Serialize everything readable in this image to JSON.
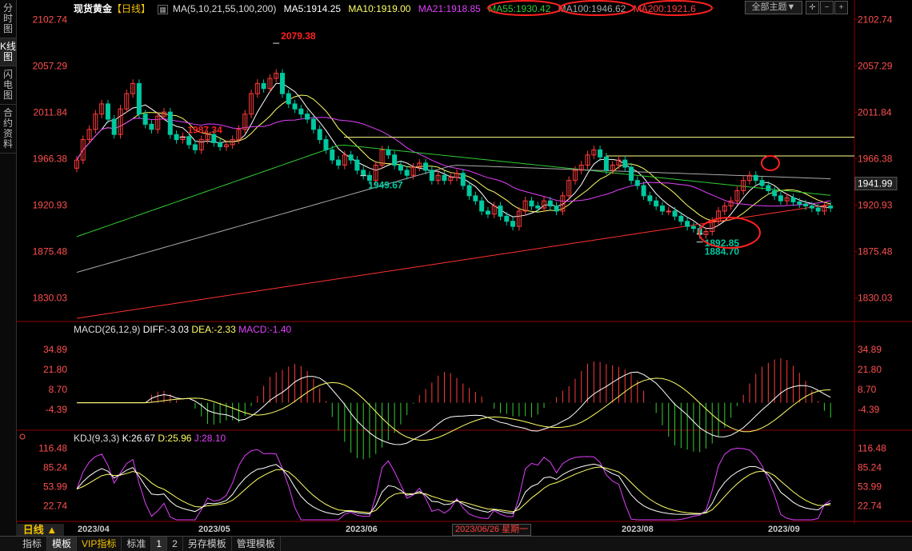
{
  "side_tabs": [
    "分时图",
    "K线图",
    "闪电图",
    "合约资料"
  ],
  "header": {
    "symbol": "现货黄金",
    "period_tag": "【日线】",
    "ma_label": "MA(5,10,21,55,100,200)",
    "ma5": "MA5:1914.25",
    "ma10": "MA10:1919.00",
    "ma21": "MA21:1918.85",
    "ma55": "MA55:1930.42",
    "ma100": "MA100:1946.62",
    "ma200": "MA200:1921.6",
    "theme_label": "全部主题▼"
  },
  "colors": {
    "up": "#ff3b3b",
    "down": "#00c8a0",
    "ma5": "#ffffff",
    "ma10": "#ffff66",
    "ma21": "#e040fb",
    "ma55": "#33cc33",
    "ma100": "#aaaaaa",
    "ma200": "#ff3030",
    "annot": "#ff2020"
  },
  "macd_header": {
    "name": "MACD(26,12,9)",
    "diff": "DIFF:-3.03",
    "dea": "DEA:-2.33",
    "macd": "MACD:-1.40"
  },
  "kdj_header": {
    "name": "KDJ(9,3,3)",
    "k": "K:26.67",
    "d": "D:25.96",
    "j": "J:28.10"
  },
  "bottom_tabs": [
    "指标",
    "模板",
    "VIP指标",
    "标准",
    "1",
    "2",
    "另存模板",
    "管理模板"
  ],
  "period_label": "日线 ▲",
  "date_labels": [
    "2023/04",
    "2023/05",
    "2023/06",
    "2023/08",
    "2023/09"
  ],
  "date_cursor": "2023/06/26 星期一",
  "chart_data": [
    {
      "type": "candlestick",
      "title": "现货黄金【日线】",
      "ylim": [
        1810,
        2110
      ],
      "y_ticks": [
        "2102.74",
        "2057.29",
        "2011.84",
        "1966.38",
        "1920.93",
        "1875.48",
        "1830.03"
      ],
      "last_price": "1941.99",
      "annotations": [
        {
          "text": "2079.38",
          "value": 2079.38
        },
        {
          "text": "1987.34",
          "value": 1987.34
        },
        {
          "text": "1949.67",
          "value": 1949.67
        },
        {
          "text": "1892.85",
          "value": 1892.85
        },
        {
          "text": "1884.70",
          "value": 1884.7
        }
      ],
      "horizontal_levels": [
        1987.34,
        1969
      ],
      "close_path": [
        1965,
        1985,
        1995,
        2010,
        2020,
        2005,
        1990,
        2015,
        2030,
        2040,
        2010,
        2000,
        1995,
        2008,
        2012,
        1990,
        1985,
        1988,
        1980,
        1975,
        1985,
        1990,
        1982,
        1978,
        1980,
        1985,
        1995,
        2010,
        2030,
        2040,
        2035,
        2045,
        2050,
        2030,
        2020,
        2015,
        2010,
        2005,
        1995,
        1985,
        1975,
        1965,
        1960,
        1970,
        1965,
        1955,
        1950,
        1945,
        1960,
        1975,
        1970,
        1960,
        1955,
        1950,
        1958,
        1962,
        1955,
        1945,
        1950,
        1945,
        1948,
        1952,
        1940,
        1930,
        1925,
        1915,
        1912,
        1920,
        1910,
        1905,
        1900,
        1915,
        1925,
        1920,
        1918,
        1925,
        1920,
        1915,
        1930,
        1945,
        1955,
        1960,
        1970,
        1975,
        1968,
        1955,
        1960,
        1965,
        1958,
        1945,
        1940,
        1930,
        1925,
        1920,
        1915,
        1915,
        1910,
        1905,
        1900,
        1898,
        1892,
        1895,
        1905,
        1915,
        1920,
        1925,
        1935,
        1945,
        1950,
        1945,
        1940,
        1935,
        1930,
        1925,
        1928,
        1924,
        1922,
        1920,
        1918,
        1915,
        1920,
        1918
      ],
      "ma_series_last": {
        "MA5": 1914.25,
        "MA10": 1919.0,
        "MA21": 1918.85,
        "MA55": 1930.42,
        "MA100": 1946.62,
        "MA200": 1921.6
      }
    },
    {
      "type": "bar",
      "title": "MACD(26,12,9)",
      "ylim": [
        -17,
        45
      ],
      "y_ticks": [
        "34.89",
        "21.80",
        "8.70",
        "-4.39"
      ],
      "diff": -3.03,
      "dea": -2.33,
      "macd": -1.4
    },
    {
      "type": "line",
      "title": "KDJ(9,3,3)",
      "ylim": [
        0,
        130
      ],
      "y_ticks": [
        "116.48",
        "85.24",
        "53.99",
        "22.74"
      ],
      "k": 26.67,
      "d": 25.96,
      "j": 28.1
    }
  ]
}
